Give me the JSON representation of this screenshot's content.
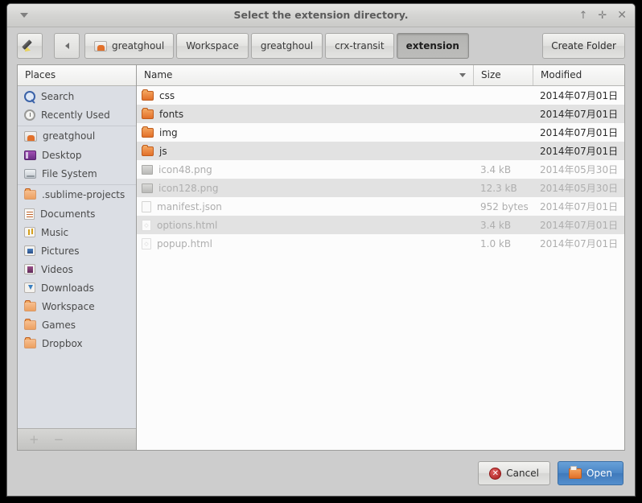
{
  "window": {
    "title": "Select the extension directory.",
    "menu_icon": "window-menu-caret-icon",
    "controls": [
      {
        "name": "shade-button",
        "glyph": "↑"
      },
      {
        "name": "maximize-button",
        "glyph": "✛"
      },
      {
        "name": "close-button",
        "glyph": "✕"
      }
    ]
  },
  "toolbar": {
    "type_name_label": "",
    "back_label": "",
    "create_folder_label": "Create Folder",
    "breadcrumbs": [
      {
        "label": "greatghoul",
        "icon": "home-folder-icon",
        "active": false
      },
      {
        "label": "Workspace",
        "icon": "",
        "active": false
      },
      {
        "label": "greatghoul",
        "icon": "",
        "active": false
      },
      {
        "label": "crx-transit",
        "icon": "",
        "active": false
      },
      {
        "label": "extension",
        "icon": "",
        "active": true
      }
    ]
  },
  "sidebar": {
    "header": "Places",
    "items": [
      {
        "label": "Search",
        "icon": "search-icon",
        "separator_before": false
      },
      {
        "label": "Recently Used",
        "icon": "clock-icon",
        "separator_before": false
      },
      {
        "label": "greatghoul",
        "icon": "home-folder-icon",
        "separator_before": true
      },
      {
        "label": "Desktop",
        "icon": "desktop-icon",
        "separator_before": false
      },
      {
        "label": "File System",
        "icon": "disk-icon",
        "separator_before": false
      },
      {
        "label": ".sublime-projects",
        "icon": "folder-icon",
        "separator_before": true
      },
      {
        "label": "Documents",
        "icon": "documents-icon",
        "separator_before": false
      },
      {
        "label": "Music",
        "icon": "music-icon",
        "separator_before": false
      },
      {
        "label": "Pictures",
        "icon": "pictures-icon",
        "separator_before": false
      },
      {
        "label": "Videos",
        "icon": "videos-icon",
        "separator_before": false
      },
      {
        "label": "Downloads",
        "icon": "downloads-icon",
        "separator_before": false
      },
      {
        "label": "Workspace",
        "icon": "folder-icon",
        "separator_before": false
      },
      {
        "label": "Games",
        "icon": "folder-icon",
        "separator_before": false
      },
      {
        "label": "Dropbox",
        "icon": "folder-icon",
        "separator_before": false
      }
    ],
    "add_label": "+",
    "remove_label": "−"
  },
  "filelist": {
    "columns": {
      "name": "Name",
      "size": "Size",
      "modified": "Modified"
    },
    "sort_column": "Name",
    "sort_direction": "descending-caret",
    "rows": [
      {
        "name": "css",
        "size": "",
        "modified": "2014年07月01日",
        "type": "folder",
        "enabled": true
      },
      {
        "name": "fonts",
        "size": "",
        "modified": "2014年07月01日",
        "type": "folder",
        "enabled": true
      },
      {
        "name": "img",
        "size": "",
        "modified": "2014年07月01日",
        "type": "folder",
        "enabled": true
      },
      {
        "name": "js",
        "size": "",
        "modified": "2014年07月01日",
        "type": "folder",
        "enabled": true
      },
      {
        "name": "icon48.png",
        "size": "3.4 kB",
        "modified": "2014年05月30日",
        "type": "image",
        "enabled": false
      },
      {
        "name": "icon128.png",
        "size": "12.3 kB",
        "modified": "2014年05月30日",
        "type": "image",
        "enabled": false
      },
      {
        "name": "manifest.json",
        "size": "952 bytes",
        "modified": "2014年07月01日",
        "type": "file",
        "enabled": false
      },
      {
        "name": "options.html",
        "size": "3.4 kB",
        "modified": "2014年07月01日",
        "type": "html",
        "enabled": false
      },
      {
        "name": "popup.html",
        "size": "1.0 kB",
        "modified": "2014年07月01日",
        "type": "html",
        "enabled": false
      }
    ]
  },
  "footer": {
    "cancel_label": "Cancel",
    "open_label": "Open"
  },
  "colors": {
    "window_bg": "#cdcdcd",
    "sidebar_bg": "#dbdee4",
    "list_bg": "#fcfcfc",
    "row_alt_bg": "#e2e2e2",
    "accent": "#4a86c6",
    "folder": "#e2702a",
    "danger": "#a81d1d",
    "disabled_text": "#aeaeae"
  }
}
